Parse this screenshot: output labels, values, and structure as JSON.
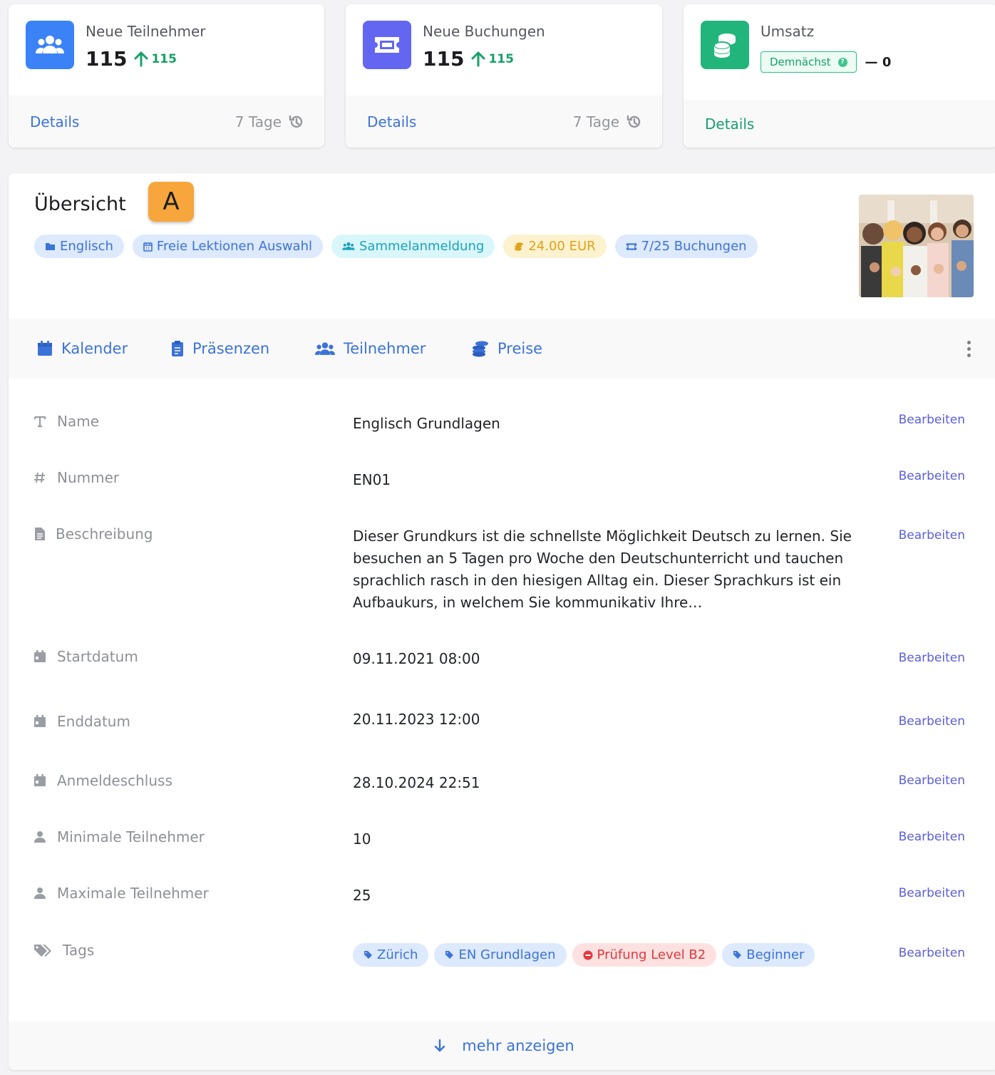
{
  "stats": [
    {
      "label": "Neue Teilnehmer",
      "value": "115",
      "delta": "115",
      "details": "Details",
      "period": "7 Tage",
      "icon": "users-icon",
      "color": "#3b82f6"
    },
    {
      "label": "Neue Buchungen",
      "value": "115",
      "delta": "115",
      "details": "Details",
      "period": "7 Tage",
      "icon": "ticket-icon",
      "color": "#6366f1"
    },
    {
      "label": "Umsatz",
      "badge": "Demnächst",
      "dash_value": "— 0",
      "details": "Details",
      "icon": "coins-icon",
      "color": "#22b57b"
    }
  ],
  "overview": {
    "title": "Übersicht",
    "marker": "A",
    "pills": [
      {
        "label": "Englisch",
        "icon": "folder-icon"
      },
      {
        "label": "Freie Lektionen Auswahl",
        "icon": "calendar-icon"
      },
      {
        "label": "Sammelanmeldung",
        "icon": "users-icon"
      },
      {
        "label": "24.00 EUR",
        "icon": "coins-icon"
      },
      {
        "label": "7/25 Buchungen",
        "icon": "ticket-icon"
      }
    ],
    "tabs": [
      {
        "label": "Kalender",
        "icon": "calendar-icon"
      },
      {
        "label": "Präsenzen",
        "icon": "clipboard-icon"
      },
      {
        "label": "Teilnehmer",
        "icon": "users-icon"
      },
      {
        "label": "Preise",
        "icon": "coins-icon"
      }
    ],
    "fields": [
      {
        "label": "Name",
        "value": "Englisch Grundlagen",
        "icon": "text-icon"
      },
      {
        "label": "Nummer",
        "value": "EN01",
        "icon": "hash-icon"
      },
      {
        "label": "Beschreibung",
        "value": "Dieser Grundkurs ist die schnellste Möglichkeit Deutsch zu lernen. Sie besuchen an 5 Tagen pro Woche den Deutschunterricht und tauchen sprachlich rasch in den hiesigen Alltag ein. Dieser Sprachkurs ist ein Aufbaukurs, in welchem Sie kommunikativ Ihre…",
        "icon": "file-icon"
      },
      {
        "label": "Startdatum",
        "value": "09.11.2021 08:00",
        "icon": "calendar-icon"
      },
      {
        "label": "Enddatum",
        "value": "20.11.2023 12:00",
        "icon": "calendar-icon"
      },
      {
        "label": "Anmeldeschluss",
        "value": "28.10.2024 22:51",
        "icon": "calendar-icon"
      },
      {
        "label": "Minimale Teilnehmer",
        "value": "10",
        "icon": "user-icon"
      },
      {
        "label": "Maximale Teilnehmer",
        "value": "25",
        "icon": "user-icon"
      },
      {
        "label": "Tags",
        "icon": "tags-icon"
      }
    ],
    "tags": [
      {
        "label": "Zürich",
        "type": "blue"
      },
      {
        "label": "EN Grundlagen",
        "type": "blue"
      },
      {
        "label": "Prüfung Level B2",
        "type": "red"
      },
      {
        "label": "Beginner",
        "type": "blue"
      }
    ],
    "edit_label": "Bearbeiten",
    "more_label": "mehr anzeigen"
  }
}
